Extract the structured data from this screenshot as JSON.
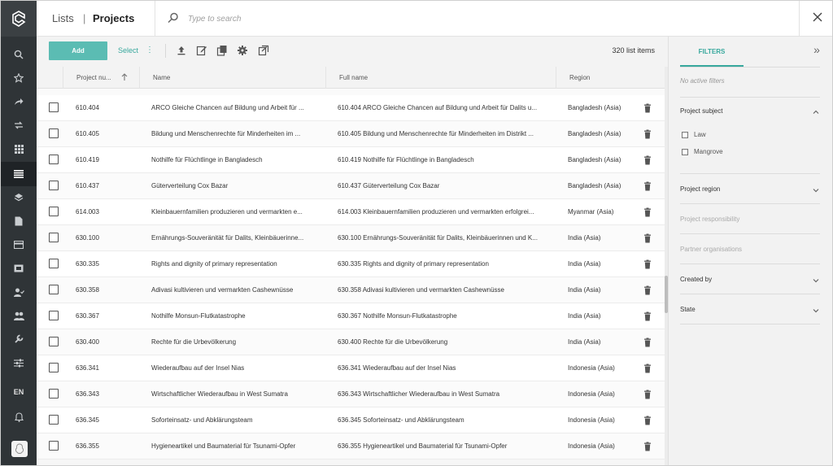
{
  "header": {
    "breadcrumb_root": "Lists",
    "breadcrumb_sep": "|",
    "page_title": "Projects",
    "search_placeholder": "Type to search"
  },
  "sidebar": {
    "language": "EN",
    "icons": [
      "search-icon",
      "star-icon",
      "share-icon",
      "transfer-icon",
      "grid-icon",
      "list-icon",
      "layers-icon",
      "document-icon",
      "card-icon",
      "wallet-icon",
      "user-check-icon",
      "users-icon",
      "wrench-icon",
      "sliders-icon"
    ],
    "active_index": 5
  },
  "toolbar": {
    "add_label": "Add",
    "select_label": "Select",
    "count_text": "320 list items"
  },
  "table": {
    "columns": [
      "Project nu...",
      "Name",
      "Full name",
      "Region"
    ],
    "rows": [
      {
        "num": "610.404",
        "name": "ARCO Gleiche Chancen auf Bildung und Arbeit für ...",
        "full": "610.404 ARCO Gleiche Chancen auf Bildung und Arbeit für Dalits u...",
        "region": "Bangladesh (Asia)"
      },
      {
        "num": "610.405",
        "name": "Bildung und Menschenrechte für Minderheiten im ...",
        "full": "610.405 Bildung und Menschenrechte für Minderheiten im Distrikt ...",
        "region": "Bangladesh (Asia)"
      },
      {
        "num": "610.419",
        "name": "Nothilfe für Flüchtlinge in Bangladesch",
        "full": "610.419 Nothilfe für Flüchtlinge in Bangladesch",
        "region": "Bangladesh (Asia)"
      },
      {
        "num": "610.437",
        "name": "Güterverteilung Cox Bazar",
        "full": "610.437 Güterverteilung Cox Bazar",
        "region": "Bangladesh (Asia)"
      },
      {
        "num": "614.003",
        "name": "Kleinbauernfamilien produzieren und vermarkten e...",
        "full": "614.003 Kleinbauernfamilien produzieren und vermarkten erfolgrei...",
        "region": "Myanmar (Asia)"
      },
      {
        "num": "630.100",
        "name": "Ernährungs-Souveränität für Dalits, Kleinbäuerinne...",
        "full": "630.100 Ernährungs-Souveränität für Dalits, Kleinbäuerinnen und K...",
        "region": "India (Asia)"
      },
      {
        "num": "630.335",
        "name": "Rights and dignity of primary representation",
        "full": "630.335 Rights and dignity of primary representation",
        "region": "India (Asia)"
      },
      {
        "num": "630.358",
        "name": "Adivasi kultivieren und vermarkten Cashewnüsse",
        "full": "630.358 Adivasi kultivieren und vermarkten Cashewnüsse",
        "region": "India (Asia)"
      },
      {
        "num": "630.367",
        "name": "Nothilfe Monsun-Flutkatastrophe",
        "full": "630.367 Nothilfe Monsun-Flutkatastrophe",
        "region": "India (Asia)"
      },
      {
        "num": "630.400",
        "name": "Rechte für die Urbevölkerung",
        "full": "630.400 Rechte für die Urbevölkerung",
        "region": "India (Asia)"
      },
      {
        "num": "636.341",
        "name": "Wiederaufbau auf der Insel Nias",
        "full": "636.341 Wiederaufbau auf der Insel Nias",
        "region": "Indonesia (Asia)"
      },
      {
        "num": "636.343",
        "name": "Wirtschaftlicher Wiederaufbau in West Sumatra",
        "full": "636.343 Wirtschaftlicher Wiederaufbau in West Sumatra",
        "region": "Indonesia (Asia)"
      },
      {
        "num": "636.345",
        "name": "Soforteinsatz- und Abklärungsteam",
        "full": "636.345 Soforteinsatz- und Abklärungsteam",
        "region": "Indonesia (Asia)"
      },
      {
        "num": "636.355",
        "name": "Hygieneartikel und Baumaterial für Tsunami-Opfer",
        "full": "636.355 Hygieneartikel und Baumaterial für Tsunami-Opfer",
        "region": "Indonesia (Asia)"
      }
    ]
  },
  "filters": {
    "tab_label": "FILTERS",
    "no_active": "No active filters",
    "sections": [
      {
        "label": "Project subject",
        "state": "expanded",
        "options": [
          "Law",
          "Mangrove"
        ]
      },
      {
        "label": "Project region",
        "state": "collapsed"
      },
      {
        "label": "Project responsibility",
        "state": "disabled"
      },
      {
        "label": "Partner organisations",
        "state": "disabled"
      },
      {
        "label": "Created by",
        "state": "collapsed"
      },
      {
        "label": "State",
        "state": "collapsed"
      }
    ]
  },
  "colors": {
    "accent": "#5bbcb3",
    "accent_text": "#38a89d",
    "sidebar": "#2f3437"
  }
}
